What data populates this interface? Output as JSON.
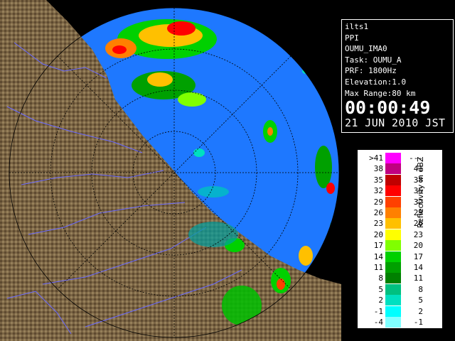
{
  "info": {
    "radar": "ilts1",
    "scan_type": "PPI",
    "site": "OUMU_IMA0",
    "task": "Task: OUMU_A",
    "prf": "PRF: 1800Hz",
    "elevation": "Elevation:1.0",
    "max_range": "Max Range:80 km",
    "time": "00:00:49",
    "date": "21 JUN 2010 JST"
  },
  "legend": {
    "unit": "Reflectivity in dBZ",
    "rows": [
      {
        "lo": ">41",
        "hi": "---",
        "color": "#ff00ff"
      },
      {
        "lo": "38",
        "hi": "41",
        "color": "#c00080"
      },
      {
        "lo": "35",
        "hi": "38",
        "color": "#c00000"
      },
      {
        "lo": "32",
        "hi": "35",
        "color": "#ff0000"
      },
      {
        "lo": "29",
        "hi": "32",
        "color": "#ff4000"
      },
      {
        "lo": "26",
        "hi": "29",
        "color": "#ff8000"
      },
      {
        "lo": "23",
        "hi": "26",
        "color": "#ffc000"
      },
      {
        "lo": "20",
        "hi": "23",
        "color": "#ffff00"
      },
      {
        "lo": "17",
        "hi": "20",
        "color": "#80ff00"
      },
      {
        "lo": "14",
        "hi": "17",
        "color": "#00d000"
      },
      {
        "lo": "11",
        "hi": "14",
        "color": "#00a000"
      },
      {
        "lo": "8",
        "hi": "11",
        "color": "#008000"
      },
      {
        "lo": "5",
        "hi": "8",
        "color": "#00c080"
      },
      {
        "lo": "2",
        "hi": "5",
        "color": "#00e0c0"
      },
      {
        "lo": "-1",
        "hi": "2",
        "color": "#00ffff"
      },
      {
        "lo": "-4",
        "hi": "-1",
        "color": "#80ffff"
      }
    ]
  },
  "colors": {
    "sea": "#1e78ff",
    "land": "#7a6444",
    "background": "#000000"
  }
}
